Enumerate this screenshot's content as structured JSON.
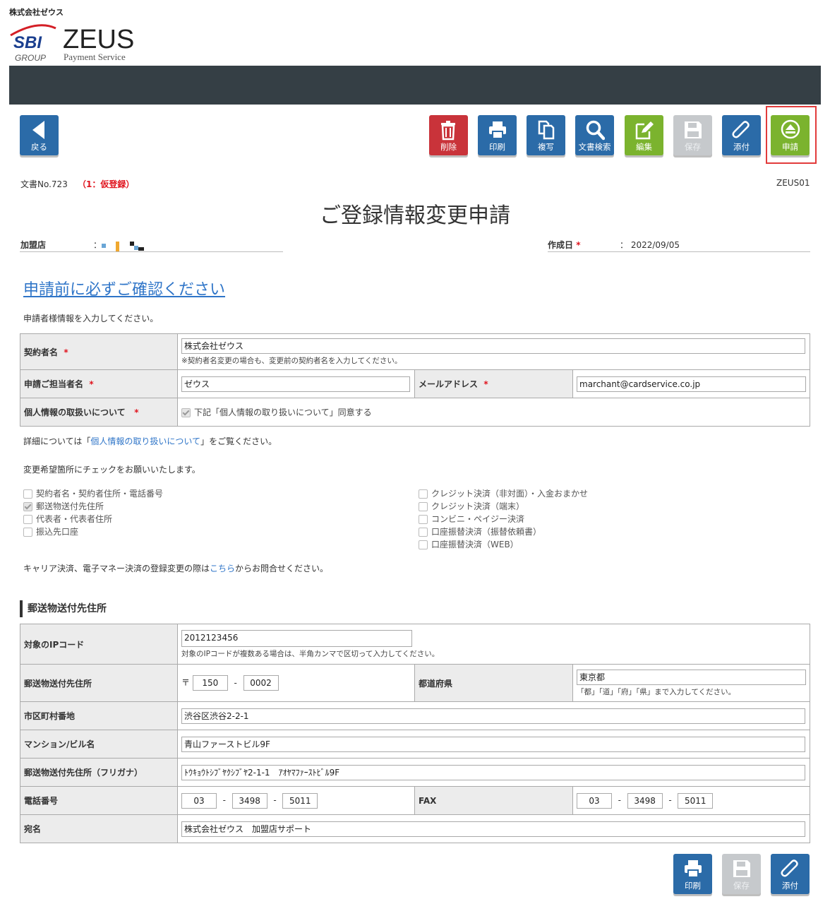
{
  "header": {
    "company": "株式会社ゼウス",
    "logo": {
      "sbi": "SBI",
      "group": "GROUP",
      "brand": "ZEUS",
      "tagline": "Payment Service"
    }
  },
  "toolbar": {
    "back": "戻る",
    "delete": "削除",
    "print": "印刷",
    "copy": "複写",
    "search": "文書検索",
    "edit": "編集",
    "save": "保存",
    "attach": "添付",
    "apply": "申請"
  },
  "doc": {
    "number": "文書No.723",
    "status": "（1：仮登録）",
    "form_code": "ZEUS01",
    "title": "ご登録情報変更申請",
    "merchant_label": "加盟店",
    "merchant_colon": "：",
    "created_label": "作成日",
    "required_mark": "*",
    "created_value": "：  2022/09/05"
  },
  "intro": {
    "confirm_link": "申請前に必ずご確認ください",
    "instruction": "申請者様情報を入力してください。"
  },
  "applicant": {
    "contractor_label": "契約者名",
    "contractor_value": "株式会社ゼウス",
    "contractor_note": "※契約者名変更の場合も、変更前の契約者名を入力してください。",
    "person_label": "申請ご担当者名",
    "person_value": "ゼウス",
    "email_label": "メールアドレス",
    "email_value": "marchant@cardservice.co.jp",
    "privacy_label": "個人情報の取扱いについて",
    "privacy_check": "下記「個人情報の取り扱いについて」同意する"
  },
  "details": {
    "prefix": "詳細については「",
    "link": "個人情報の取り扱いについて",
    "suffix": "」をご覧ください。"
  },
  "changes": {
    "instruction": "変更希望箇所にチェックをお願いいたします。",
    "left": [
      {
        "label": "契約者名・契約者住所・電話番号",
        "checked": false
      },
      {
        "label": "郵送物送付先住所",
        "checked": true
      },
      {
        "label": "代表者・代表者住所",
        "checked": false
      },
      {
        "label": "振込先口座",
        "checked": false
      }
    ],
    "right": [
      {
        "label": "クレジット決済（非対面）・入金おまかせ",
        "checked": false
      },
      {
        "label": "クレジット決済（端末）",
        "checked": false
      },
      {
        "label": "コンビニ・ペイジー決済",
        "checked": false
      },
      {
        "label": "口座振替決済（振替依頼書）",
        "checked": false
      },
      {
        "label": "口座振替決済（WEB）",
        "checked": false
      }
    ],
    "carrier_prefix": "キャリア決済、電子マネー決済の登録変更の際は",
    "carrier_link": "こちら",
    "carrier_suffix": "からお問合せください。"
  },
  "mailing": {
    "section_title": "郵送物送付先住所",
    "ip_label": "対象のIPコード",
    "ip_value": "2012123456",
    "ip_note": "対象のIPコードが複数ある場合は、半角カンマで区切って入力してください。",
    "postal_label": "郵送物送付先住所",
    "postal_mark": "〒",
    "postal1": "150",
    "postal2": "0002",
    "pref_label": "都道府県",
    "pref_value": "東京都",
    "pref_note": "「都」「道」「府」「県」まで入力してください。",
    "city_label": "市区町村番地",
    "city_value": "渋谷区渋谷2-2-1",
    "building_label": "マンション/ビル名",
    "building_value": "青山ファーストビル9F",
    "kana_label": "郵送物送付先住所（フリガナ）",
    "kana_value": "ﾄｳｷｮｳﾄｼﾌﾞﾔｸｼﾌﾞﾔ2-1-1　ｱｵﾔﾏﾌｧｰｽﾄﾋﾞﾙ9F",
    "tel_label": "電話番号",
    "tel": [
      "03",
      "3498",
      "5011"
    ],
    "fax_label": "FAX",
    "fax": [
      "03",
      "3498",
      "5011"
    ],
    "addressee_label": "宛名",
    "addressee_value": "株式会社ゼウス　加盟店サポート",
    "dash": "-"
  },
  "colors": {
    "banner": "#353f45",
    "blue": "#2b6ba8",
    "red": "#c9333a",
    "green": "#7bb32e",
    "gray": "#c6c9cc"
  }
}
